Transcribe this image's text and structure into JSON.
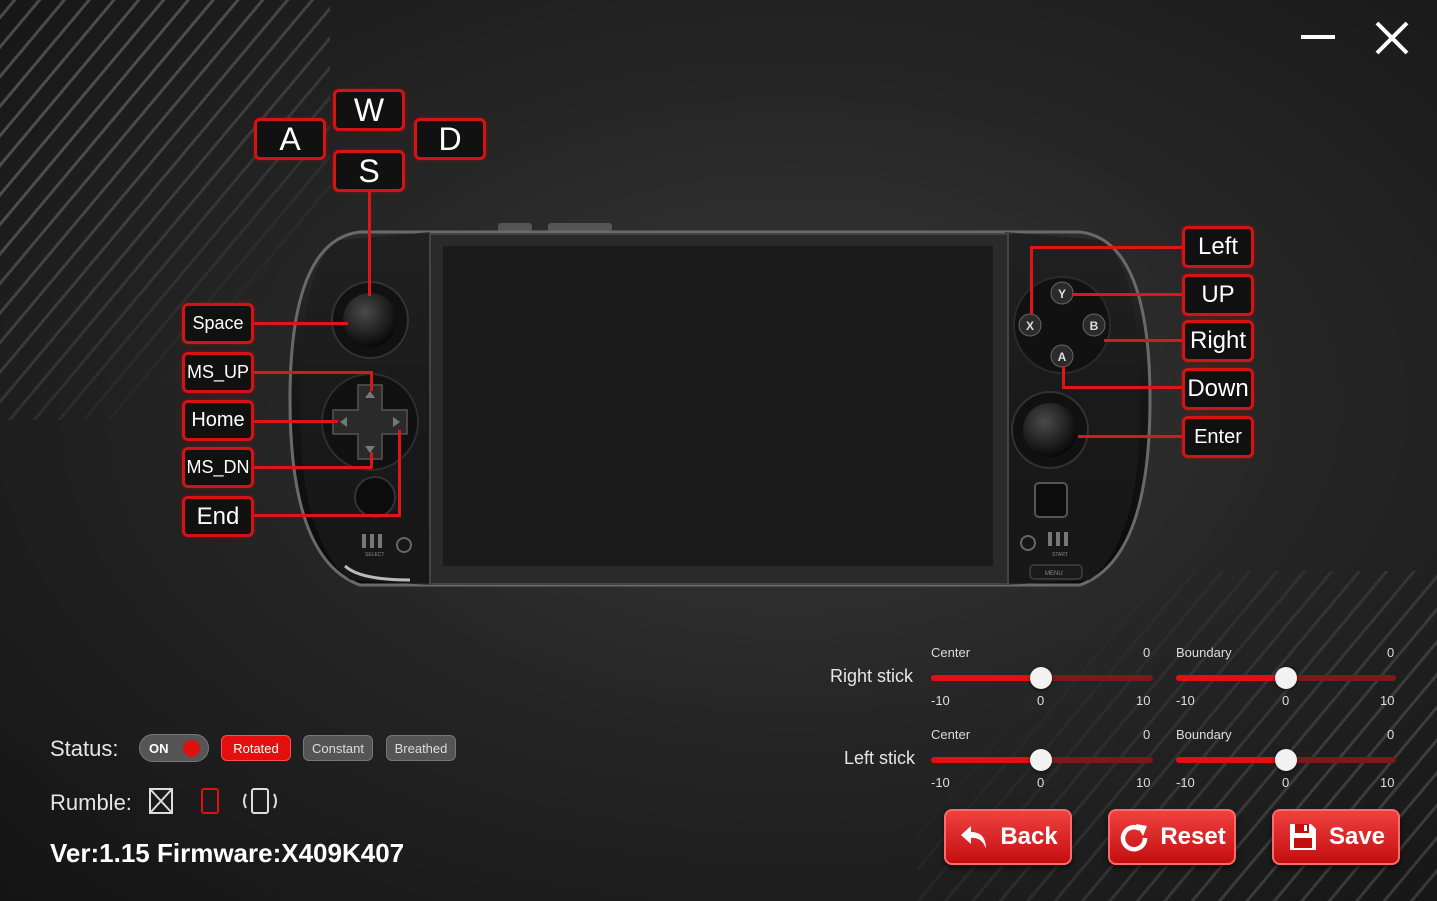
{
  "window": {
    "minimize_icon": "minimize-icon",
    "close_icon": "close-icon"
  },
  "keys": {
    "w": "W",
    "a": "A",
    "s": "S",
    "d": "D",
    "space": "Space",
    "ms_up": "MS_UP",
    "home": "Home",
    "ms_dn": "MS_DN",
    "end": "End",
    "left": "Left",
    "up": "UP",
    "right": "Right",
    "down": "Down",
    "enter": "Enter"
  },
  "face_buttons": {
    "y": "Y",
    "x": "X",
    "b": "B",
    "a": "A"
  },
  "device_labels": {
    "select": "SELECT",
    "start": "START",
    "menu": "MENU"
  },
  "status": {
    "label": "Status:",
    "toggle": "ON",
    "modes": [
      "Rotated",
      "Constant",
      "Breathed"
    ],
    "active_mode": "Rotated"
  },
  "rumble": {
    "label": "Rumble:",
    "icons": [
      "rumble-off-icon",
      "rumble-weak-icon",
      "rumble-strong-icon"
    ],
    "active": "rumble-weak-icon"
  },
  "version": "Ver:1.15 Firmware:X409K407",
  "sticks": [
    {
      "label": "Right stick",
      "center": {
        "label": "Center",
        "value": 0,
        "min": "-10",
        "mid": "0",
        "max": "10"
      },
      "boundary": {
        "label": "Boundary",
        "value": 0,
        "min": "-10",
        "mid": "0",
        "max": "10"
      }
    },
    {
      "label": "Left stick",
      "center": {
        "label": "Center",
        "value": 0,
        "min": "-10",
        "mid": "0",
        "max": "10"
      },
      "boundary": {
        "label": "Boundary",
        "value": 0,
        "min": "-10",
        "mid": "0",
        "max": "10"
      }
    }
  ],
  "buttons": {
    "back": "Back",
    "reset": "Reset",
    "save": "Save"
  },
  "colors": {
    "accent": "#e41010",
    "background": "#262626"
  }
}
